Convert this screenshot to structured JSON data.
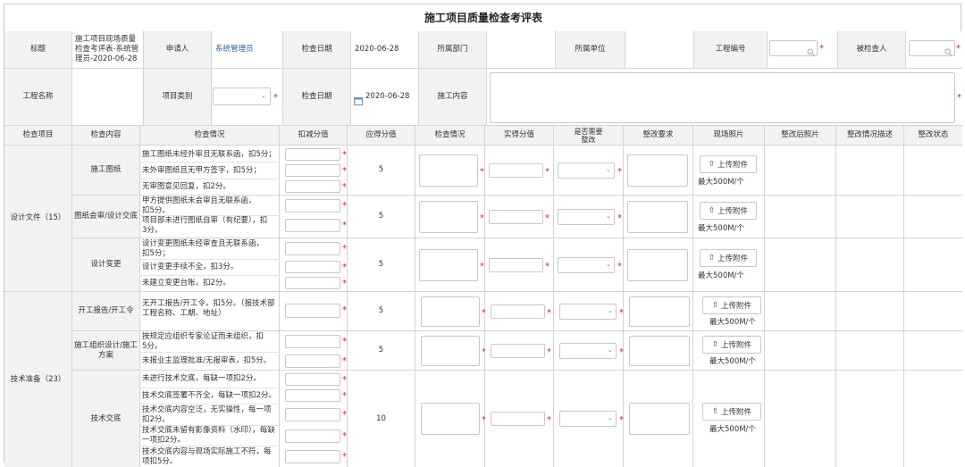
{
  "title": "施工项目质量检查考评表",
  "form": {
    "r1": {
      "subject_label": "标题",
      "subject_value": "施工项目现场质量检查考评表-系统管理员-2020-06-28",
      "applicant_label": "申请人",
      "applicant_value": "系统管理员",
      "check_date_label": "检查日期",
      "check_date_value": "2020-06-28",
      "dept_label": "所属部门",
      "unit_label": "所属单位",
      "project_no_label": "工程编号",
      "inspected_label": "被检查人"
    },
    "r2": {
      "project_name_label": "工程名称",
      "project_type_label": "项目类别",
      "check_date_label": "检查日期",
      "check_date_value": "2020-06-28",
      "content_label": "施工内容"
    }
  },
  "headers": [
    "检查项目",
    "检查内容",
    "检查情况",
    "扣减分值",
    "应得分值",
    "检查情况",
    "实得分值",
    "是否需要整改",
    "整改要求",
    "现场照片",
    "整改后照片",
    "整改情况描述",
    "整改状态"
  ],
  "upload": {
    "label": "上传附件",
    "note": "最大500M/个"
  },
  "groups": [
    {
      "name": "设计文件（15）",
      "items": [
        {
          "content": "施工图纸",
          "score": "5",
          "criteria": [
            "施工图纸未经外审且无联系函，扣5分；",
            "未外审图纸且无甲方签字，扣5分；",
            "无审图意见回复，扣2分。"
          ]
        },
        {
          "content": "图纸会审/设计交底",
          "score": "5",
          "criteria": [
            "甲方提供图纸未会审且无联系函，扣5分。",
            "项目部未进行图纸自审（有纪要），扣3分。"
          ]
        },
        {
          "content": "设计变更",
          "score": "5",
          "criteria": [
            "设计变更图纸未经审查且无联系函，扣5分；",
            "设计变更手续不全，扣3分。",
            "未建立变更台账，扣2分。"
          ]
        }
      ]
    },
    {
      "name": "技术准备（23）",
      "items": [
        {
          "content": "开工报告/开工令",
          "score": "5",
          "criteria": [
            "无开工报告/开工令，扣5分。（报技术部工程名称、工期、地址）"
          ]
        },
        {
          "content": "施工组织设计/施工方案",
          "score": "5",
          "criteria": [
            "按规定应组织专家论证而未组织，扣5分。",
            "未报业主监理批准/无报审表，扣5分。"
          ]
        },
        {
          "content": "技术交底",
          "score": "10",
          "criteria": [
            "未进行技术交底，每缺一项扣2分。",
            "技术交底签署不齐全，每缺一项扣2分。",
            "技术交底内容空泛，无实操性，每一项扣2分。",
            "技术交底未留有影像资料（水印），每缺一项扣2分。",
            "技术交底内容与现场实际施工不符，每项扣5分。"
          ]
        }
      ]
    }
  ]
}
